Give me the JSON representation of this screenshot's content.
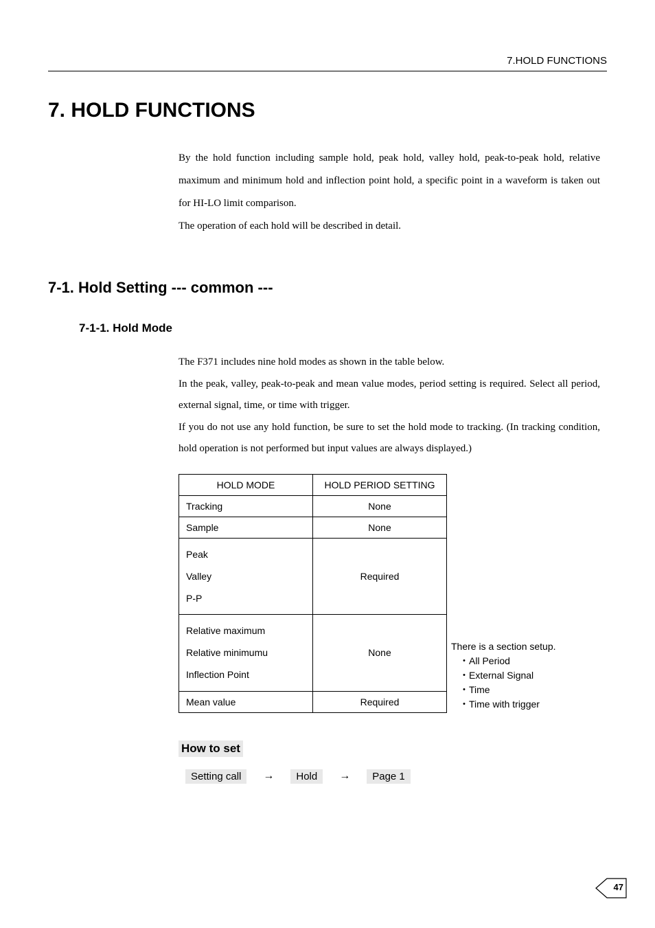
{
  "header": {
    "running_title": "7.HOLD FUNCTIONS"
  },
  "chapter": {
    "title": "7. HOLD FUNCTIONS"
  },
  "intro": {
    "para1": "By the hold function including sample hold, peak hold, valley hold, peak-to-peak hold, relative maximum and minimum hold and inflection point hold, a specific point in a waveform is taken out for HI-LO limit comparison.",
    "para2": "The operation of each hold will be described in detail."
  },
  "section": {
    "title": "7-1. Hold Setting  --- common ---"
  },
  "subsection": {
    "title": "7-1-1. Hold Mode",
    "para1": "The F371 includes nine hold modes as shown in the table below.",
    "para2": "In the peak, valley, peak-to-peak and mean value modes, period setting is required. Select all period, external signal, time, or time with trigger.",
    "para3": "If you do not use any hold function, be sure to set the hold mode to tracking. (In tracking condition, hold operation is not performed but input values are always displayed.)"
  },
  "table": {
    "headers": {
      "mode": "HOLD  MODE",
      "period": "HOLD PERIOD SETTING"
    },
    "rows": {
      "r1": {
        "mode": "Tracking",
        "period": "None"
      },
      "r2": {
        "mode": "Sample",
        "period": "None"
      },
      "r3a": "Peak",
      "r3b": "Valley",
      "r3c": "P-P",
      "r3period": "Required",
      "r4a": "Relative maximum",
      "r4b": "Relative minimumu",
      "r4c": "Inflection Point",
      "r4period": "None",
      "r5": {
        "mode": "Mean value",
        "period": "Required"
      }
    }
  },
  "sidenote": {
    "line1": "There is a section setup.",
    "item1": "・All Period",
    "item2": "・External Signal",
    "item3": "・Time",
    "item4": "・Time with trigger"
  },
  "howto": {
    "heading": "How to set",
    "step1": "Setting call",
    "arrow": "→",
    "step2": "Hold",
    "step3": "Page 1"
  },
  "page": {
    "number": "47"
  }
}
